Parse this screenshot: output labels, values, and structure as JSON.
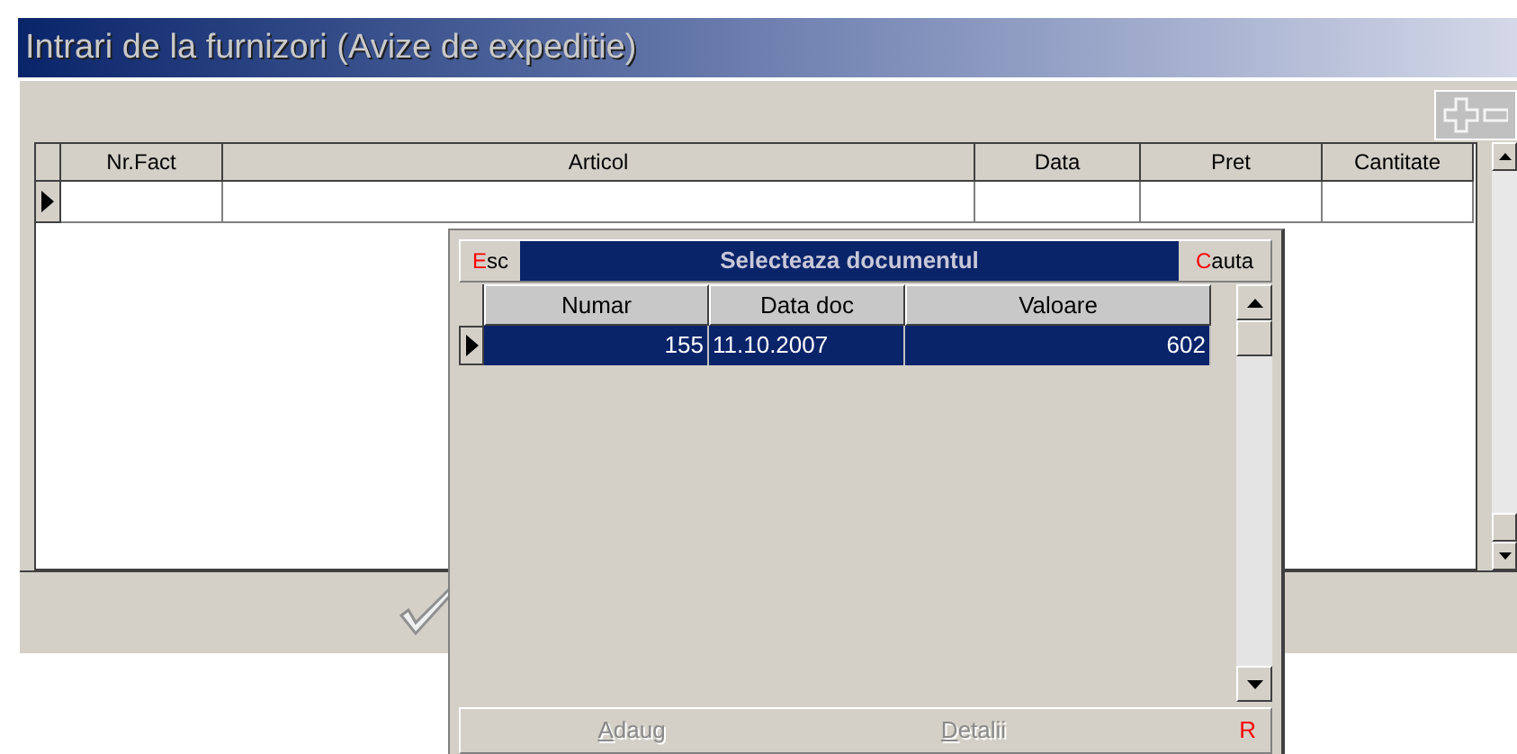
{
  "window": {
    "title": "Intrari de la furnizori (Avize de expeditie)"
  },
  "toolbar": {
    "add": {
      "disabled": true
    },
    "remove": {
      "disabled": true
    }
  },
  "table": {
    "columns": [
      "Nr.Fact",
      "Articol",
      "Data",
      "Pret",
      "Cantitate"
    ],
    "rows": [
      {
        "selected": true
      }
    ]
  },
  "confirm": {
    "disabled": true
  },
  "dialog": {
    "title": "Selecteaza documentul",
    "esc": {
      "hotkey": "E",
      "rest": "sc"
    },
    "search": {
      "hotkey": "C",
      "rest": "auta"
    },
    "columns": [
      "Numar",
      "Data doc",
      "Valoare"
    ],
    "rows": [
      {
        "selected": true,
        "cells": [
          "155",
          "11.10.2007",
          "602"
        ]
      }
    ],
    "buttons": [
      {
        "hotkey": "A",
        "rest": "daug",
        "disabled": true
      },
      {
        "hotkey": "D",
        "rest": "etalii",
        "disabled": true
      }
    ],
    "flag": "R"
  }
}
